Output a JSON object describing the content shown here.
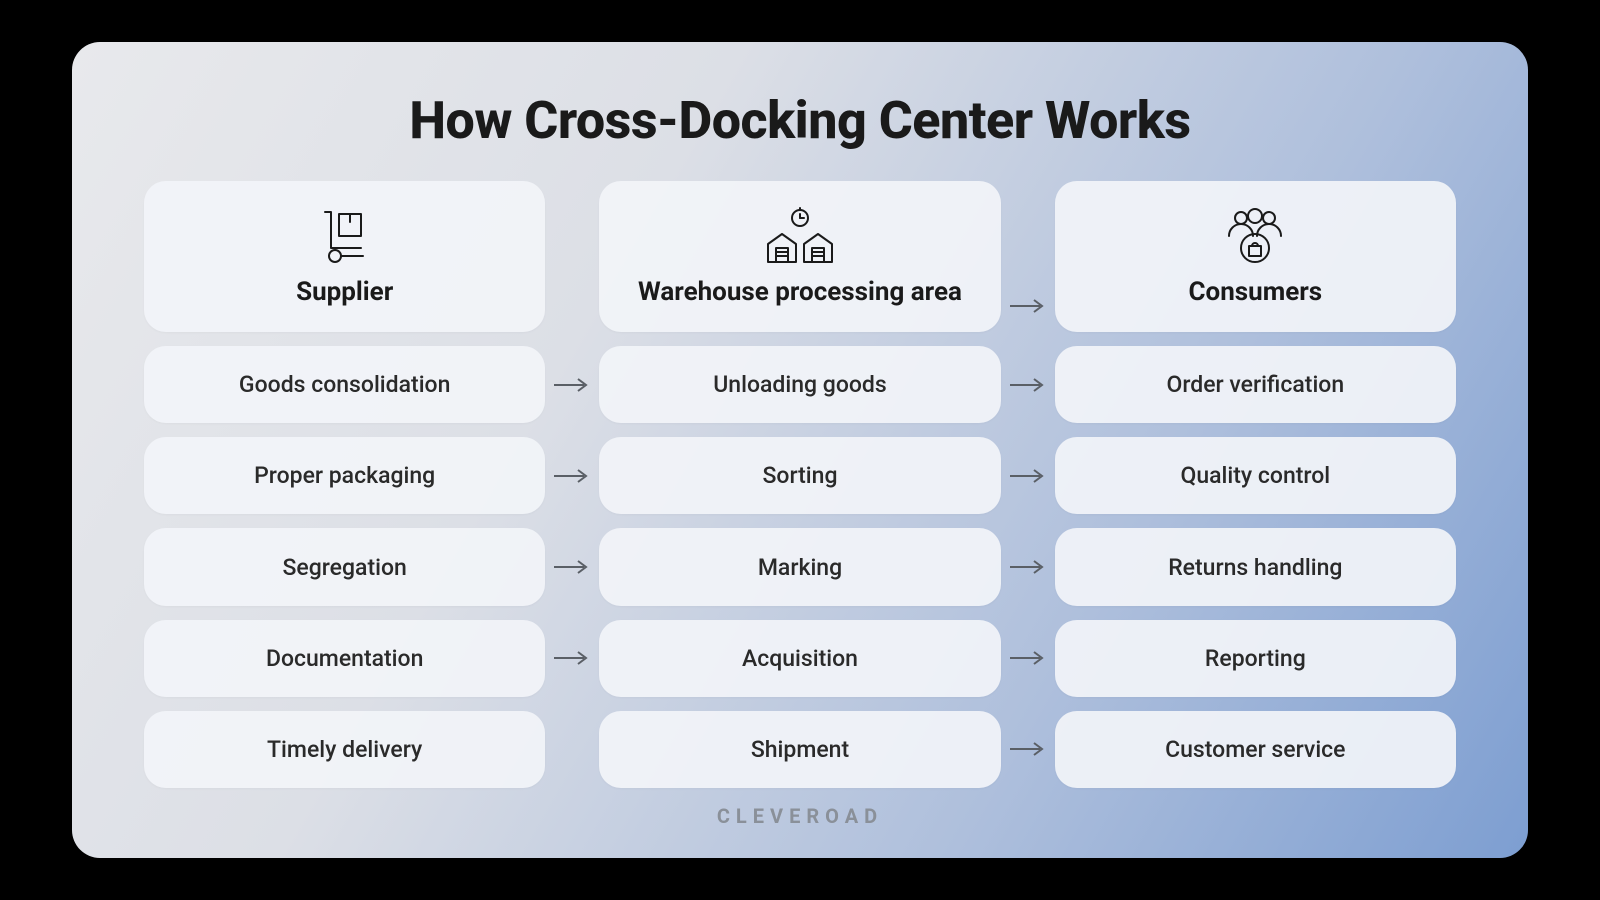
{
  "title": "How Cross-Docking Center Works",
  "brand": "CLEVEROAD",
  "columns": [
    {
      "icon": "hand-truck-icon",
      "label": "Supplier",
      "steps": [
        "Goods consolidation",
        "Proper packaging",
        "Segregation",
        "Documentation",
        "Timely delivery"
      ]
    },
    {
      "icon": "warehouse-icon",
      "label": "Warehouse processing area",
      "steps": [
        "Unloading goods",
        "Sorting",
        "Marking",
        "Acquisition",
        "Shipment"
      ]
    },
    {
      "icon": "consumers-icon",
      "label": "Consumers",
      "steps": [
        "Order verification",
        "Quality control",
        "Returns handling",
        "Reporting",
        "Customer service"
      ]
    }
  ],
  "arrows_between_col1_col2_rows": [
    1,
    2,
    3,
    4
  ],
  "arrows_between_col2_col3_rows": [
    0,
    1,
    2,
    3,
    4,
    5
  ]
}
